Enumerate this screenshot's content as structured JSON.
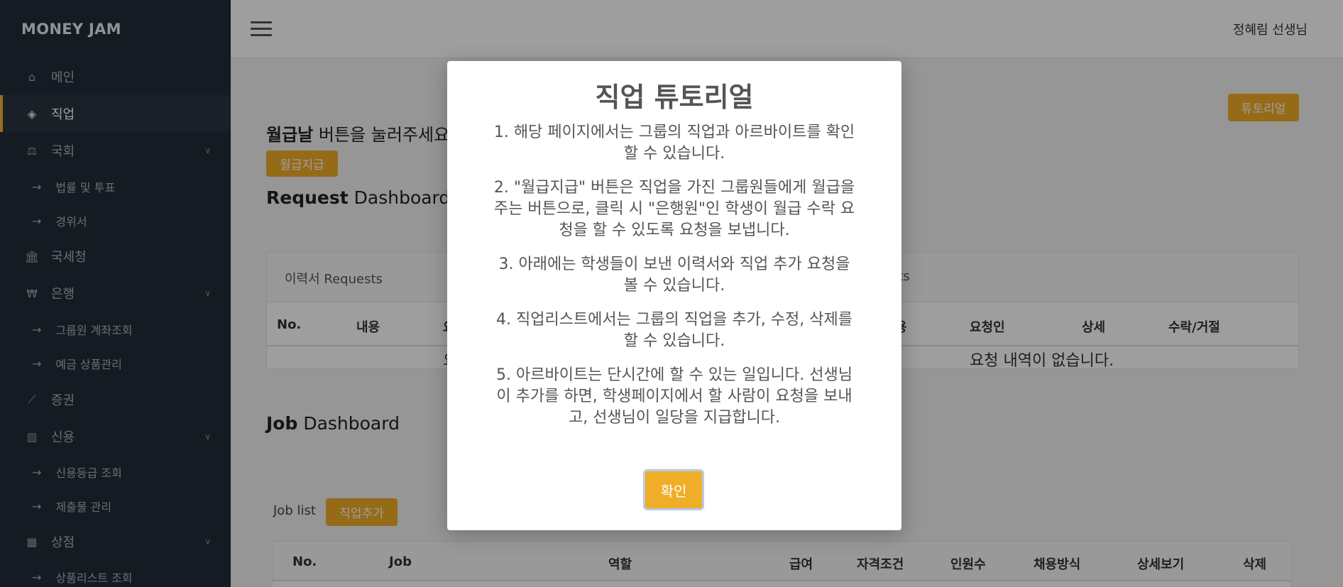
{
  "brand": "MONEY JAM",
  "sidebar": {
    "items": [
      {
        "label": "메인",
        "icon": "home-icon"
      },
      {
        "label": "직업",
        "icon": "tags-icon"
      },
      {
        "label": "국회",
        "icon": "scale-icon"
      },
      {
        "label": "법률 및 투표"
      },
      {
        "label": "경위서"
      },
      {
        "label": "국세청",
        "icon": "bank-icon"
      },
      {
        "label": "은행",
        "icon": "won-icon"
      },
      {
        "label": "그룹원 계좌조회"
      },
      {
        "label": "예금 상품관리"
      },
      {
        "label": "증권",
        "icon": "chart-line-icon"
      },
      {
        "label": "신용",
        "icon": "bar-chart-icon"
      },
      {
        "label": "신용등급 조회"
      },
      {
        "label": "제출물 관리"
      },
      {
        "label": "상점",
        "icon": "building-icon"
      },
      {
        "label": "상품리스트 조회"
      }
    ],
    "active_index": 1
  },
  "topbar": {
    "username": "정혜림 선생님"
  },
  "main": {
    "tutorial_button": "튜토리얼",
    "payday_bold": "월급날",
    "payday_rest": " 버튼을 눌러주세요",
    "pay_button": "월급지급",
    "request_bold": "Request",
    "request_rest": " Dashboard",
    "request_tab_left": "이력서 Requests",
    "request_tab_right": "sts",
    "request_headers": [
      "No.",
      "내용",
      "요",
      "용",
      "요청인",
      "상세",
      "수락/거절"
    ],
    "request_empty_left": "요",
    "request_empty": "요청 내역이 없습니다.",
    "job_bold": "Job",
    "job_rest": " Dashboard",
    "job_list_label": "Job list",
    "add_job_button": "직업추가",
    "job_headers": [
      "No.",
      "Job",
      "역할",
      "급여",
      "자격조건",
      "인원수",
      "채용방식",
      "상세보기",
      "삭제"
    ]
  },
  "modal": {
    "title": "직업 튜토리얼",
    "paragraphs": [
      "1. 해당 페이지에서는 그룹의 직업과 아르바이트를 확인할 수 있습니다.",
      "2. \"월급지급\" 버튼은 직업을 가진 그룹원들에게 월급을 주는 버튼으로, 클릭 시 \"은행원\"인 학생이 월급 수락 요청을 할 수 있도록 요청을 보냅니다.",
      "3. 아래에는 학생들이 보낸 이력서와 직업 추가 요청을 볼 수 있습니다.",
      "4. 직업리스트에서는 그룹의 직업을 추가, 수정, 삭제를 할 수 있습니다.",
      "5. 아르바이트는 단시간에 할 수 있는 일입니다. 선생님이 추가를 하면, 학생페이지에서 할 사람이 요청을 보내고, 선생님이 일당을 지급합니다."
    ],
    "confirm": "확인"
  },
  "colors": {
    "accent": "#f0ad28",
    "sidebar_bg": "#212c38",
    "overlay": "rgba(0,0,0,0.38)"
  }
}
